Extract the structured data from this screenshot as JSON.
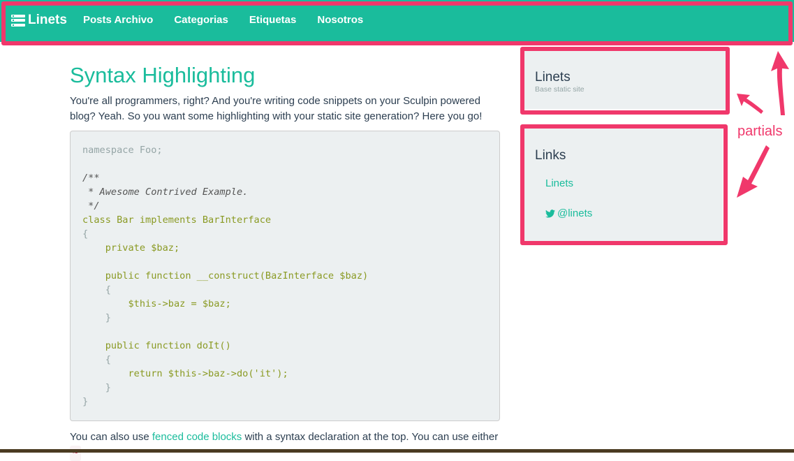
{
  "navbar": {
    "brand": "Linets",
    "links": [
      "Posts Archivo",
      "Categorias",
      "Etiquetas",
      "Nosotros"
    ]
  },
  "post": {
    "title": "Syntax Highlighting",
    "intro": "You're all programmers, right? And you're writing code snippets on your Sculpin powered blog? Yeah. So you want some highlighting with your static site generation? Here you go!",
    "after_code_prefix": "You can also use ",
    "after_code_link": "fenced code blocks",
    "after_code_suffix": " with a syntax declaration at the top. You can use either ",
    "after_code_tilde": "~"
  },
  "code": {
    "lines": [
      "namespace Foo;",
      "",
      "/**",
      " * Awesome Contrived Example.",
      " */",
      "class Bar implements BarInterface",
      "{",
      "    private $baz;",
      "",
      "    public function __construct(BazInterface $baz)",
      "    {",
      "        $this->baz = $baz;",
      "    }",
      "",
      "    public function doIt()",
      "    {",
      "        return $this->baz->do('it');",
      "    }",
      "}"
    ]
  },
  "sidebar": {
    "about": {
      "title": "Linets",
      "subtitle": "Base static site"
    },
    "links": {
      "title": "Links",
      "items": [
        {
          "label": "Linets",
          "icon": ""
        },
        {
          "label": "@linets",
          "icon": "twitter-icon"
        }
      ]
    }
  },
  "annotation": {
    "label": "partials",
    "color": "#f0386b"
  },
  "colors": {
    "brand": "#1abc9c",
    "text": "#2c3e50",
    "panel": "#ecf0f1",
    "highlight": "#f0386b"
  }
}
